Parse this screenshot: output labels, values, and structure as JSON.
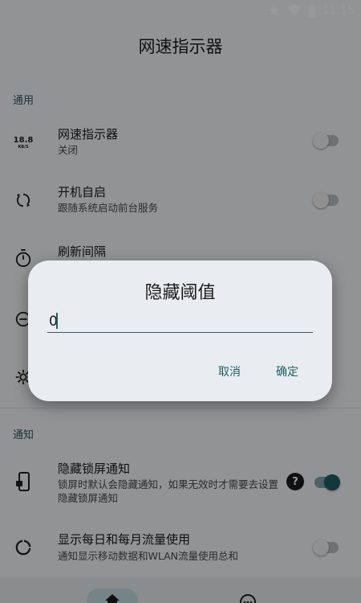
{
  "status_bar": {
    "time": "11:15"
  },
  "app_title": "网速指示器",
  "sections": {
    "general": "通用",
    "notification": "通知"
  },
  "settings": {
    "speed_indicator": {
      "icon_text_top": "18.8",
      "icon_text_bottom": "KB/S",
      "title": "网速指示器",
      "subtitle": "关闭",
      "switch": "off"
    },
    "autostart": {
      "title": "开机自启",
      "subtitle": "跟随系统启动前台服务",
      "switch": "off"
    },
    "refresh_interval": {
      "title": "刷新间隔"
    },
    "hide_lockscreen": {
      "title": "隐藏锁屏通知",
      "subtitle": "锁屏时默认会隐藏通知，如果无效时才需要去设置隐藏锁屏通知",
      "help": "?",
      "switch": "on"
    },
    "daily_monthly": {
      "title": "显示每日和每月流量使用",
      "subtitle": "通知显示移动数据和WLAN流量使用总和",
      "switch": "off"
    }
  },
  "dialog": {
    "title": "隐藏阈值",
    "input_value": "0",
    "cancel_label": "取消",
    "confirm_label": "确定"
  },
  "colors": {
    "accent": "#1f5e66",
    "dialog_bg": "#e9edf1",
    "page_bg": "#f4f5f7"
  }
}
